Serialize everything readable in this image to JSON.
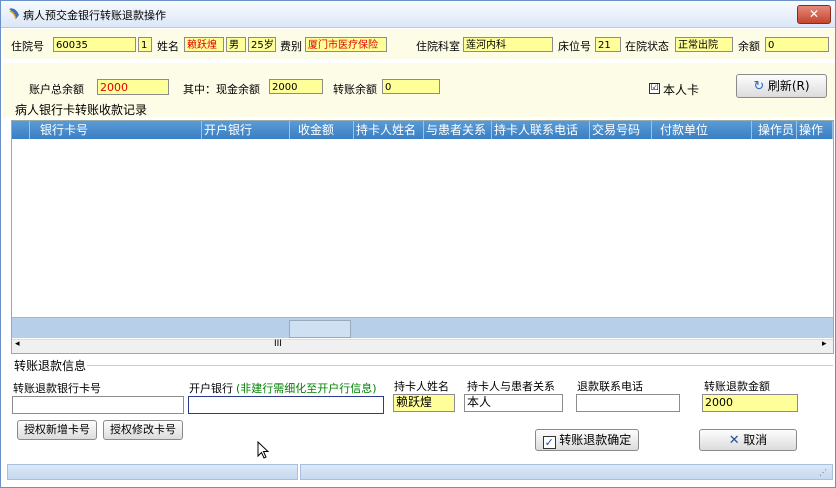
{
  "window": {
    "title": "病人预交金银行转账退款操作",
    "close_label": "✕"
  },
  "patient": {
    "inpatient_no_label": "住院号",
    "inpatient_no": "60035",
    "times": "1",
    "name_label": "姓名",
    "name": "赖跃煌",
    "sex": "男",
    "age": "25岁",
    "fee_type_label": "费别",
    "fee_type": "厦门市医疗保险",
    "dept_label": "住院科室",
    "dept": "莲河内科",
    "bed_label": "床位号",
    "bed": "21",
    "status_label": "在院状态",
    "status": "正常出院",
    "balance_label": "余额",
    "balance": "0"
  },
  "account": {
    "total_label": "账户总余额",
    "total": "2000",
    "cash_label": "其中：现金余额",
    "cash": "2000",
    "transfer_label": "转账余额",
    "transfer": "0",
    "own_card_label": "本人卡",
    "own_card_checked": "☑",
    "refresh_label": "刷新(R)"
  },
  "records": {
    "section_title": "病人银行卡转账收款记录",
    "columns": [
      "银行卡号",
      "开户银行",
      "收金额",
      "持卡人姓名",
      "与患者关系",
      "持卡人联系电话",
      "交易号码",
      "付款单位",
      "操作员",
      "操作"
    ],
    "rows": [],
    "scroll_marker": "III"
  },
  "refund": {
    "section_title": "转账退款信息",
    "card_no_label": "转账退款银行卡号",
    "card_no": "",
    "bank_label": "开户银行",
    "bank_hint": "(非建行需细化至开户行信息)",
    "bank": "",
    "holder_label": "持卡人姓名",
    "holder": "赖跃煌",
    "relation_label": "持卡人与患者关系",
    "relation": "本人",
    "phone_label": "退款联系电话",
    "phone": "",
    "amount_label": "转账退款金额",
    "amount": "2000",
    "add_card_label": "授权新增卡号",
    "edit_card_label": "授权修改卡号",
    "confirm_label": "转账退款确定",
    "cancel_label": "取消"
  },
  "colors": {
    "accent": "#3a7fc4",
    "highlight": "#ffff99",
    "warning_text": "#e00000",
    "hint_text": "#008000"
  }
}
